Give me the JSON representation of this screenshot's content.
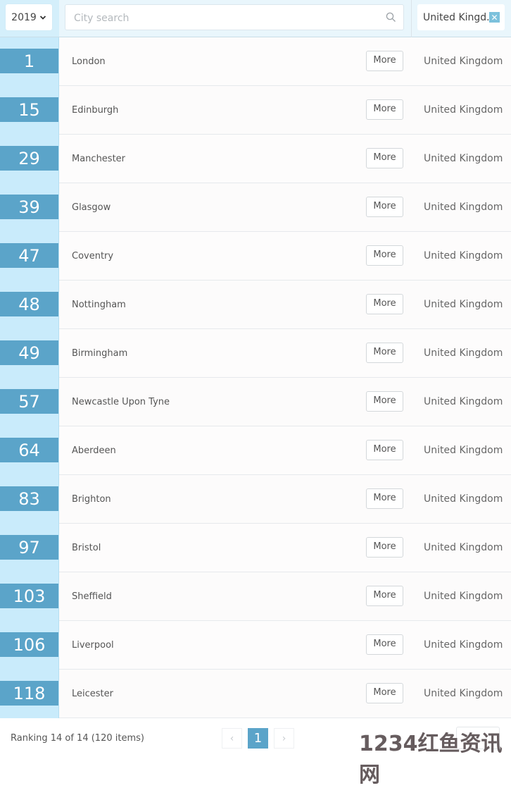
{
  "toolbar": {
    "year_selected": "2019",
    "search_placeholder": "City search",
    "search_value": "",
    "country_filter": "United Kingd...",
    "clear_filter_glyph": "✕"
  },
  "rows": [
    {
      "rank": "1",
      "city": "London",
      "more_label": "More",
      "country": "United Kingdom"
    },
    {
      "rank": "15",
      "city": "Edinburgh",
      "more_label": "More",
      "country": "United Kingdom"
    },
    {
      "rank": "29",
      "city": "Manchester",
      "more_label": "More",
      "country": "United Kingdom"
    },
    {
      "rank": "39",
      "city": "Glasgow",
      "more_label": "More",
      "country": "United Kingdom"
    },
    {
      "rank": "47",
      "city": "Coventry",
      "more_label": "More",
      "country": "United Kingdom"
    },
    {
      "rank": "48",
      "city": "Nottingham",
      "more_label": "More",
      "country": "United Kingdom"
    },
    {
      "rank": "49",
      "city": "Birmingham",
      "more_label": "More",
      "country": "United Kingdom"
    },
    {
      "rank": "57",
      "city": "Newcastle Upon Tyne",
      "more_label": "More",
      "country": "United Kingdom"
    },
    {
      "rank": "64",
      "city": "Aberdeen",
      "more_label": "More",
      "country": "United Kingdom"
    },
    {
      "rank": "83",
      "city": "Brighton",
      "more_label": "More",
      "country": "United Kingdom"
    },
    {
      "rank": "97",
      "city": "Bristol",
      "more_label": "More",
      "country": "United Kingdom"
    },
    {
      "rank": "103",
      "city": "Sheffield",
      "more_label": "More",
      "country": "United Kingdom"
    },
    {
      "rank": "106",
      "city": "Liverpool",
      "more_label": "More",
      "country": "United Kingdom"
    },
    {
      "rank": "118",
      "city": "Leicester",
      "more_label": "More",
      "country": "United Kingdom"
    }
  ],
  "footer": {
    "summary": "Ranking 14 of 14 (120 items)",
    "prev_glyph": "‹",
    "current_page": "1",
    "next_glyph": "›"
  },
  "watermark": "1234红鱼资讯网",
  "colors": {
    "accent": "#5ba4c9",
    "rank_column_bg": "#c9ebfb"
  }
}
